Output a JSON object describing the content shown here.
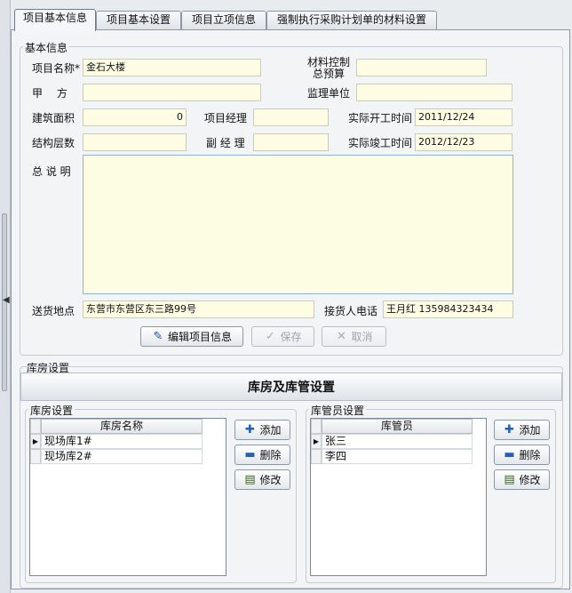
{
  "tabs": [
    {
      "label": "项目基本信息"
    },
    {
      "label": "项目基本设置"
    },
    {
      "label": "项目立项信息"
    },
    {
      "label": "强制执行采购计划单的材料设置"
    }
  ],
  "basic_info": {
    "legend": "基本信息",
    "project_name_label": "项目名称*",
    "project_name_value": "金石大楼",
    "material_budget_label_1": "材料控制",
    "material_budget_label_2": "总预算",
    "material_budget_value": "",
    "party_a_label": "甲　 方",
    "party_a_value": "",
    "supervisor_label": "监理单位",
    "supervisor_value": "",
    "area_label": "建筑面积",
    "area_value": "0",
    "manager_label": "项目经理",
    "manager_value": "",
    "start_label": "实际开工时间",
    "start_value": "2011/12/24",
    "floors_label": "结构层数",
    "floors_value": "",
    "deputy_label": "副 经 理",
    "deputy_value": "",
    "finish_label": "实际竣工时间",
    "finish_value": "2012/12/23",
    "description_label": "总 说 明",
    "description_value": "",
    "address_label": "送货地点",
    "address_value": "东营市东营区东三路99号",
    "receiver_label": "接货人电话",
    "receiver_value": "王月红  135984323434"
  },
  "actions": {
    "edit_label": "编辑项目信息",
    "save_label": "保存",
    "cancel_label": "取消"
  },
  "warehouse": {
    "section_label": "库房设置",
    "title": "库房及库管设置",
    "warehouse_group": "库房设置",
    "warehouse_column": "库房名称",
    "warehouses": [
      "现场库1#",
      "现场库2#"
    ],
    "keeper_group": "库管员设置",
    "keeper_column": "库管员",
    "keepers": [
      "张三",
      "李四"
    ],
    "add_label": "添加",
    "delete_label": "删除",
    "modify_label": "修改"
  },
  "colors": {
    "input_bg": "#fefde3",
    "add_icon": "#1f5fbf",
    "delete_icon": "#1f5fbf"
  }
}
